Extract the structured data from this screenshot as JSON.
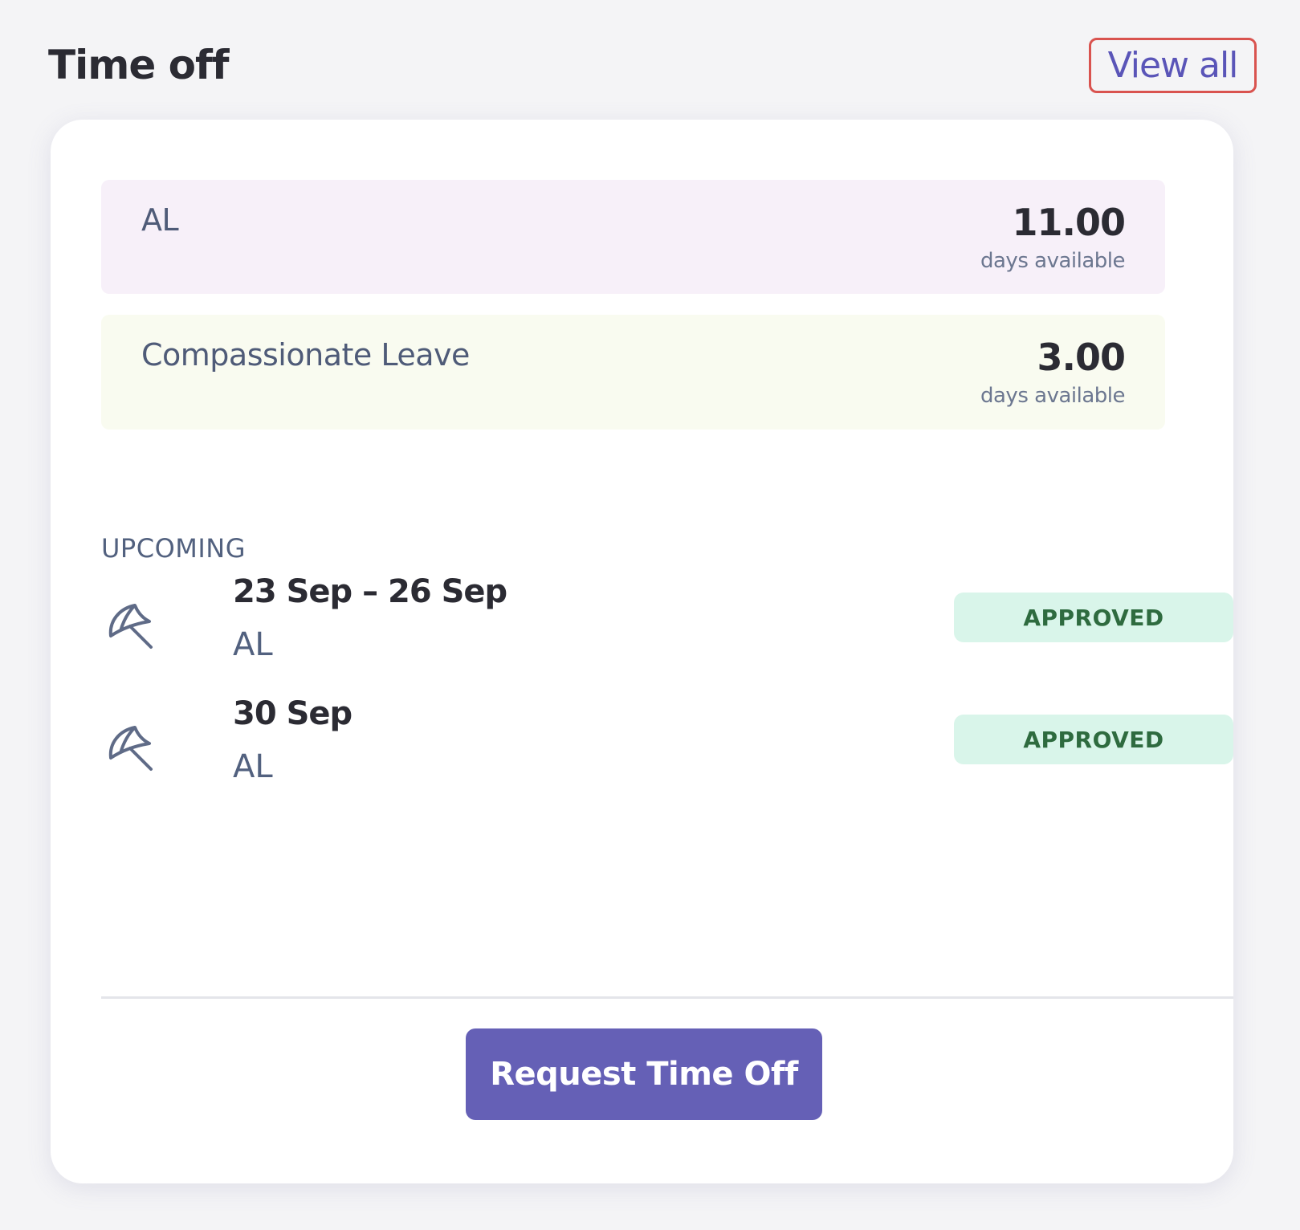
{
  "header": {
    "title": "Time off",
    "view_all_label": "View all"
  },
  "balances": [
    {
      "name": "AL",
      "value": "11.00",
      "unit": "days available",
      "color": "#f7f0f9"
    },
    {
      "name": "Compassionate Leave",
      "value": "3.00",
      "unit": "days available",
      "color": "#f9fbf0"
    }
  ],
  "upcoming": {
    "label": "UPCOMING",
    "items": [
      {
        "dates": "23 Sep – 26 Sep",
        "type": "AL",
        "status": "APPROVED",
        "icon": "umbrella-icon"
      },
      {
        "dates": "30 Sep",
        "type": "AL",
        "status": "APPROVED",
        "icon": "umbrella-icon"
      }
    ]
  },
  "actions": {
    "request_label": "Request Time Off"
  },
  "colors": {
    "accent": "#6560b6",
    "approved_bg": "#d9f5ea",
    "approved_text": "#2e6b3f",
    "highlight_border": "#d9534f"
  }
}
